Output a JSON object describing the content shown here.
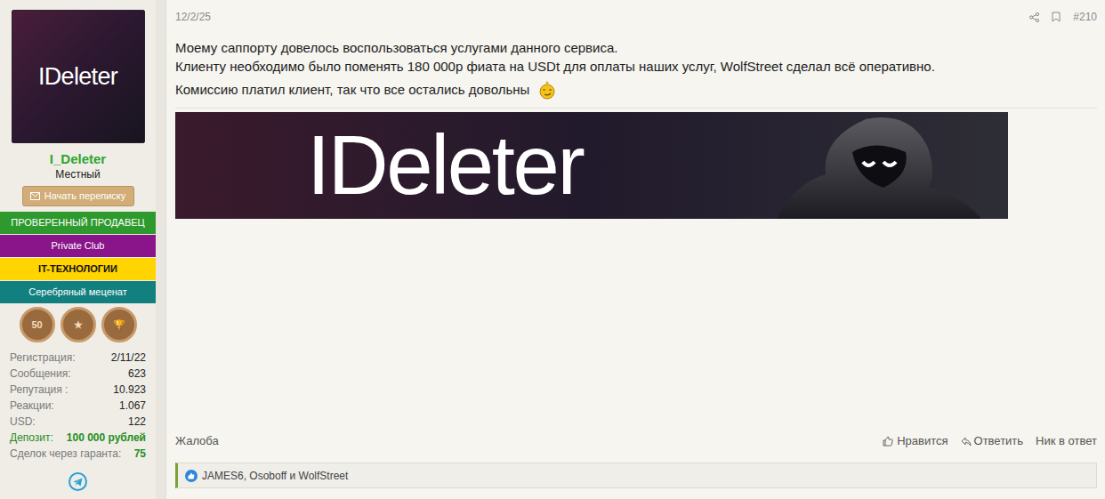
{
  "user": {
    "avatar_text": "IDeleter",
    "name": "I_Deleter",
    "title": "Местный",
    "message_button": "Начать переписку",
    "banners": [
      {
        "text": "ПРОВЕРЕННЫЙ ПРОДАВЕЦ",
        "color": "#2e9a2e",
        "text_color": "#ffffff"
      },
      {
        "text": "Private Club",
        "color": "#8a148a",
        "text_color": "#ffffff"
      },
      {
        "text": "IT-ТЕХНОЛОГИИ",
        "color": "#ffd400",
        "text_color": "#111111"
      },
      {
        "text": "Серебряный меценат",
        "color": "#138080",
        "text_color": "#ffffff"
      }
    ],
    "trophies": [
      "50",
      "★",
      "🏆"
    ],
    "stats": [
      {
        "label": "Регистрация:",
        "value": "2/11/22",
        "kind": "plain"
      },
      {
        "label": "Сообщения:",
        "value": "623",
        "kind": "plain"
      },
      {
        "label": "Репутация :",
        "value": "10.923",
        "kind": "plain"
      },
      {
        "label": "Реакции:",
        "value": "1.067",
        "kind": "plain"
      },
      {
        "label": "USD:",
        "value": "122",
        "kind": "plain"
      },
      {
        "label": "Депозит:",
        "value": "100 000 рублей",
        "kind": "money"
      },
      {
        "label": "Сделок через гаранта:",
        "value": "75",
        "kind": "count"
      }
    ]
  },
  "post": {
    "date": "12/2/25",
    "number": "#210",
    "paragraphs": [
      "Моему саппорту довелось воспользоваться услугами данного сервиса.",
      "Клиенту необходимо было поменять 180 000р фиата на USDt для оплаты наших услуг, WolfStreet сделал всё оперативно.",
      "Комиссию платил клиент, так что все остались довольны"
    ],
    "banner_text": "IDeleter"
  },
  "actions": {
    "report": "Жалоба",
    "like": "Нравится",
    "reply": "Ответить",
    "quote_nick": "Ник в ответ"
  },
  "reactions": {
    "text": "JAMES6, Osoboff и WolfStreet"
  }
}
